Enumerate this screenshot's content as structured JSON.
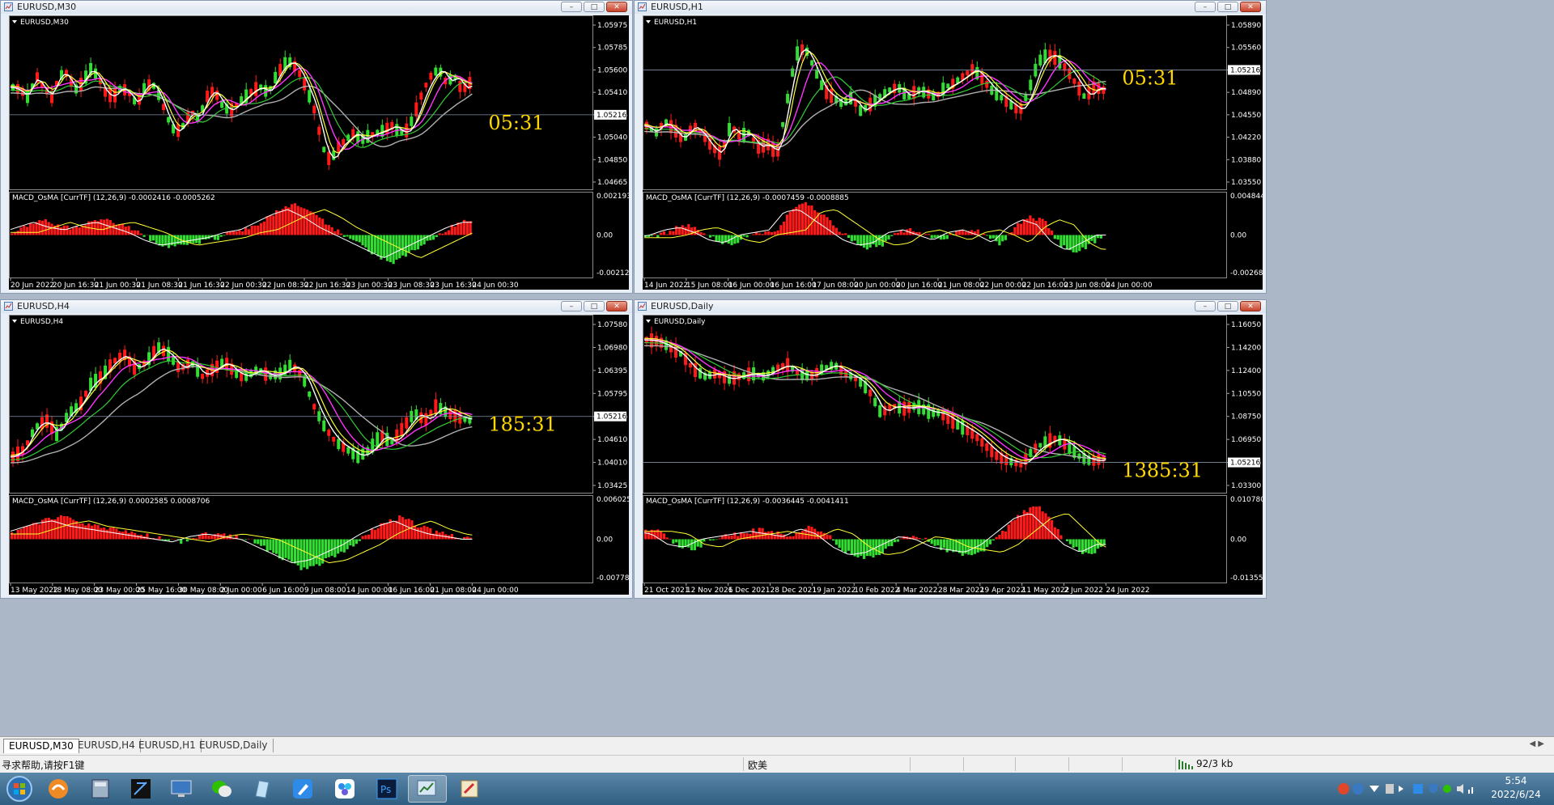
{
  "charts": [
    {
      "title": "EURUSD,M30",
      "symbol_label": "EURUSD,M30",
      "indicator_label": "MACD_OsMA [CurrTF] (12,26,9) -0.0002416 -0.0005262",
      "timer": "05:31",
      "current_price": "1.05216",
      "price_axis": [
        "1.05975",
        "1.05785",
        "1.05600",
        "1.05410",
        "1.05216",
        "1.05040",
        "1.04850",
        "1.04665"
      ],
      "macd_axis": [
        "0.002193",
        "0.00",
        "-0.002127"
      ],
      "time_axis": [
        "20 Jun 2022",
        "20 Jun 16:30",
        "21 Jun 00:30",
        "21 Jun 08:30",
        "21 Jun 16:30",
        "22 Jun 00:30",
        "22 Jun 08:30",
        "22 Jun 16:30",
        "23 Jun 00:30",
        "23 Jun 08:30",
        "23 Jun 16:30",
        "24 Jun 00:30"
      ],
      "price_trace": [
        0.62,
        0.6,
        0.55,
        0.7,
        0.62,
        0.55,
        0.7,
        0.72,
        0.6,
        0.65,
        0.75,
        0.7,
        0.58,
        0.55,
        0.62,
        0.58,
        0.5,
        0.62,
        0.65,
        0.55,
        0.4,
        0.3,
        0.35,
        0.45,
        0.4,
        0.55,
        0.6,
        0.5,
        0.45,
        0.5,
        0.55,
        0.6,
        0.62,
        0.58,
        0.7,
        0.78,
        0.8,
        0.72,
        0.6,
        0.45,
        0.2,
        0.1,
        0.2,
        0.25,
        0.3,
        0.25,
        0.28,
        0.3,
        0.32,
        0.35,
        0.3,
        0.32,
        0.45,
        0.6,
        0.7,
        0.75,
        0.65,
        0.7,
        0.6,
        0.65
      ],
      "macd_trace": [
        0.1,
        0.3,
        0.5,
        0.3,
        0.2,
        0.4,
        0.5,
        0.3,
        0.1,
        -0.2,
        -0.4,
        -0.3,
        -0.2,
        -0.1,
        0.1,
        0.2,
        0.5,
        0.8,
        1.0,
        0.7,
        0.3,
        0.0,
        -0.3,
        -0.6,
        -0.9,
        -0.6,
        -0.3,
        0.0,
        0.3,
        0.5
      ]
    },
    {
      "title": "EURUSD,H1",
      "symbol_label": "EURUSD,H1",
      "indicator_label": "MACD_OsMA [CurrTF] (12,26,9) -0.0007459 -0.0008885",
      "timer": "05:31",
      "current_price": "1.05216",
      "price_axis": [
        "1.05890",
        "1.05560",
        "1.05216",
        "1.04890",
        "1.04550",
        "1.04220",
        "1.03880",
        "1.03550"
      ],
      "macd_axis": [
        "0.0048447",
        "0.00",
        "-0.002687"
      ],
      "time_axis": [
        "14 Jun 2022",
        "15 Jun 08:00",
        "16 Jun 00:00",
        "16 Jun 16:00",
        "17 Jun 08:00",
        "20 Jun 00:00",
        "20 Jun 16:00",
        "21 Jun 08:00",
        "22 Jun 00:00",
        "22 Jun 16:00",
        "23 Jun 08:00",
        "24 Jun 00:00"
      ],
      "price_trace": [
        0.35,
        0.3,
        0.38,
        0.32,
        0.25,
        0.35,
        0.3,
        0.2,
        0.15,
        0.35,
        0.28,
        0.3,
        0.2,
        0.22,
        0.15,
        0.5,
        0.85,
        0.9,
        0.75,
        0.6,
        0.55,
        0.5,
        0.55,
        0.45,
        0.5,
        0.55,
        0.6,
        0.62,
        0.55,
        0.6,
        0.58,
        0.55,
        0.62,
        0.65,
        0.7,
        0.75,
        0.68,
        0.6,
        0.55,
        0.5,
        0.45,
        0.6,
        0.8,
        0.85,
        0.82,
        0.75,
        0.65,
        0.55,
        0.62,
        0.6
      ],
      "macd_trace": [
        -0.1,
        0.0,
        0.2,
        0.3,
        0.1,
        -0.2,
        -0.3,
        0.0,
        0.1,
        0.2,
        0.9,
        1.0,
        0.6,
        0.2,
        -0.2,
        -0.4,
        -0.3,
        0.1,
        0.2,
        0.0,
        -0.2,
        0.1,
        0.2,
        0.0,
        -0.3,
        0.3,
        0.6,
        0.4,
        -0.3,
        -0.6,
        -0.3,
        0.0
      ]
    },
    {
      "title": "EURUSD,H4",
      "symbol_label": "EURUSD,H4",
      "indicator_label": "MACD_OsMA [CurrTF] (12,26,9) 0.0002585 0.0008706",
      "timer": "185:31",
      "current_price": "1.05216",
      "price_axis": [
        "1.07580",
        "1.06980",
        "1.06395",
        "1.05795",
        "1.05216",
        "1.04610",
        "1.04010",
        "1.03425"
      ],
      "macd_axis": [
        "0.0060256",
        "0.00",
        "-0.007783"
      ],
      "time_axis": [
        "13 May 2022",
        "18 May 08:00",
        "23 May 00:00",
        "25 May 16:00",
        "30 May 08:00",
        "2 Jun 00:00",
        "6 Jun 16:00",
        "9 Jun 08:00",
        "14 Jun 00:00",
        "16 Jun 16:00",
        "21 Jun 08:00",
        "24 Jun 00:00"
      ],
      "price_trace": [
        0.15,
        0.2,
        0.35,
        0.4,
        0.3,
        0.45,
        0.5,
        0.65,
        0.7,
        0.8,
        0.85,
        0.75,
        0.8,
        0.9,
        0.85,
        0.75,
        0.8,
        0.7,
        0.75,
        0.8,
        0.72,
        0.7,
        0.75,
        0.7,
        0.72,
        0.78,
        0.7,
        0.5,
        0.35,
        0.25,
        0.2,
        0.15,
        0.2,
        0.3,
        0.25,
        0.35,
        0.45,
        0.4,
        0.5,
        0.45,
        0.42,
        0.4
      ],
      "macd_trace": [
        0.2,
        0.4,
        0.6,
        0.7,
        0.5,
        0.4,
        0.3,
        0.2,
        0.1,
        0.0,
        -0.1,
        0.1,
        0.2,
        0.1,
        0.0,
        -0.3,
        -0.6,
        -0.9,
        -0.8,
        -0.5,
        -0.2,
        0.2,
        0.5,
        0.7,
        0.4,
        0.2,
        0.1,
        0.0
      ]
    },
    {
      "title": "EURUSD,Daily",
      "symbol_label": "EURUSD,Daily",
      "indicator_label": "MACD_OsMA [CurrTF] (12,26,9) -0.0036445 -0.0041411",
      "timer": "1385:31",
      "current_price": "1.05216",
      "price_axis": [
        "1.16050",
        "1.14200",
        "1.12400",
        "1.10550",
        "1.08750",
        "1.06950",
        "1.05216",
        "1.03300"
      ],
      "macd_axis": [
        "0.0107807",
        "0.00",
        "-0.013557"
      ],
      "time_axis": [
        "21 Oct 2021",
        "12 Nov 2021",
        "6 Dec 2021",
        "28 Dec 2021",
        "19 Jan 2022",
        "10 Feb 2022",
        "4 Mar 2022",
        "28 Mar 2022",
        "19 Apr 2022",
        "11 May 2022",
        "2 Jun 2022",
        "24 Jun 2022"
      ],
      "price_trace": [
        0.95,
        0.94,
        0.9,
        0.85,
        0.75,
        0.7,
        0.72,
        0.68,
        0.7,
        0.72,
        0.7,
        0.75,
        0.78,
        0.72,
        0.7,
        0.75,
        0.78,
        0.72,
        0.68,
        0.6,
        0.45,
        0.5,
        0.48,
        0.5,
        0.46,
        0.45,
        0.4,
        0.35,
        0.3,
        0.22,
        0.15,
        0.12,
        0.1,
        0.2,
        0.25,
        0.28,
        0.22,
        0.15,
        0.12,
        0.14
      ],
      "macd_trace": [
        0.3,
        0.2,
        -0.2,
        -0.3,
        0.0,
        0.1,
        0.2,
        0.3,
        0.2,
        0.1,
        0.4,
        0.2,
        -0.3,
        -0.6,
        -0.5,
        -0.2,
        0.1,
        0.0,
        -0.3,
        -0.4,
        -0.5,
        -0.2,
        0.3,
        0.8,
        1.0,
        0.4,
        -0.2,
        -0.5,
        -0.2
      ]
    }
  ],
  "colors": {
    "bull": "#ff1a1a",
    "bear": "#33dd33",
    "ma_fast": "#ffffff",
    "ma_yellow": "#ffff33",
    "ma_magenta": "#ff33ff",
    "ma_green": "#33cc33",
    "ma_gray": "#b0b0b0",
    "timer": "#ffd700"
  },
  "tabs": [
    "EURUSD,M30",
    "EURUSD,H4",
    "EURUSD,H1",
    "EURUSD,Daily"
  ],
  "active_tab": "EURUSD,M30",
  "status": {
    "help": "寻求帮助,请按F1键",
    "profile": "欧美",
    "traffic": "92/3 kb"
  },
  "taskbar": {
    "apps": [
      "start-orb",
      "browser-app",
      "calculator-app",
      "terminal-app",
      "monitor-app",
      "wechat-app",
      "notes-app",
      "edit-app",
      "mindmap-app",
      "photoshop-app",
      "metatrader-app",
      "tools-app"
    ],
    "time": "5:54",
    "date": "2022/6/24"
  }
}
